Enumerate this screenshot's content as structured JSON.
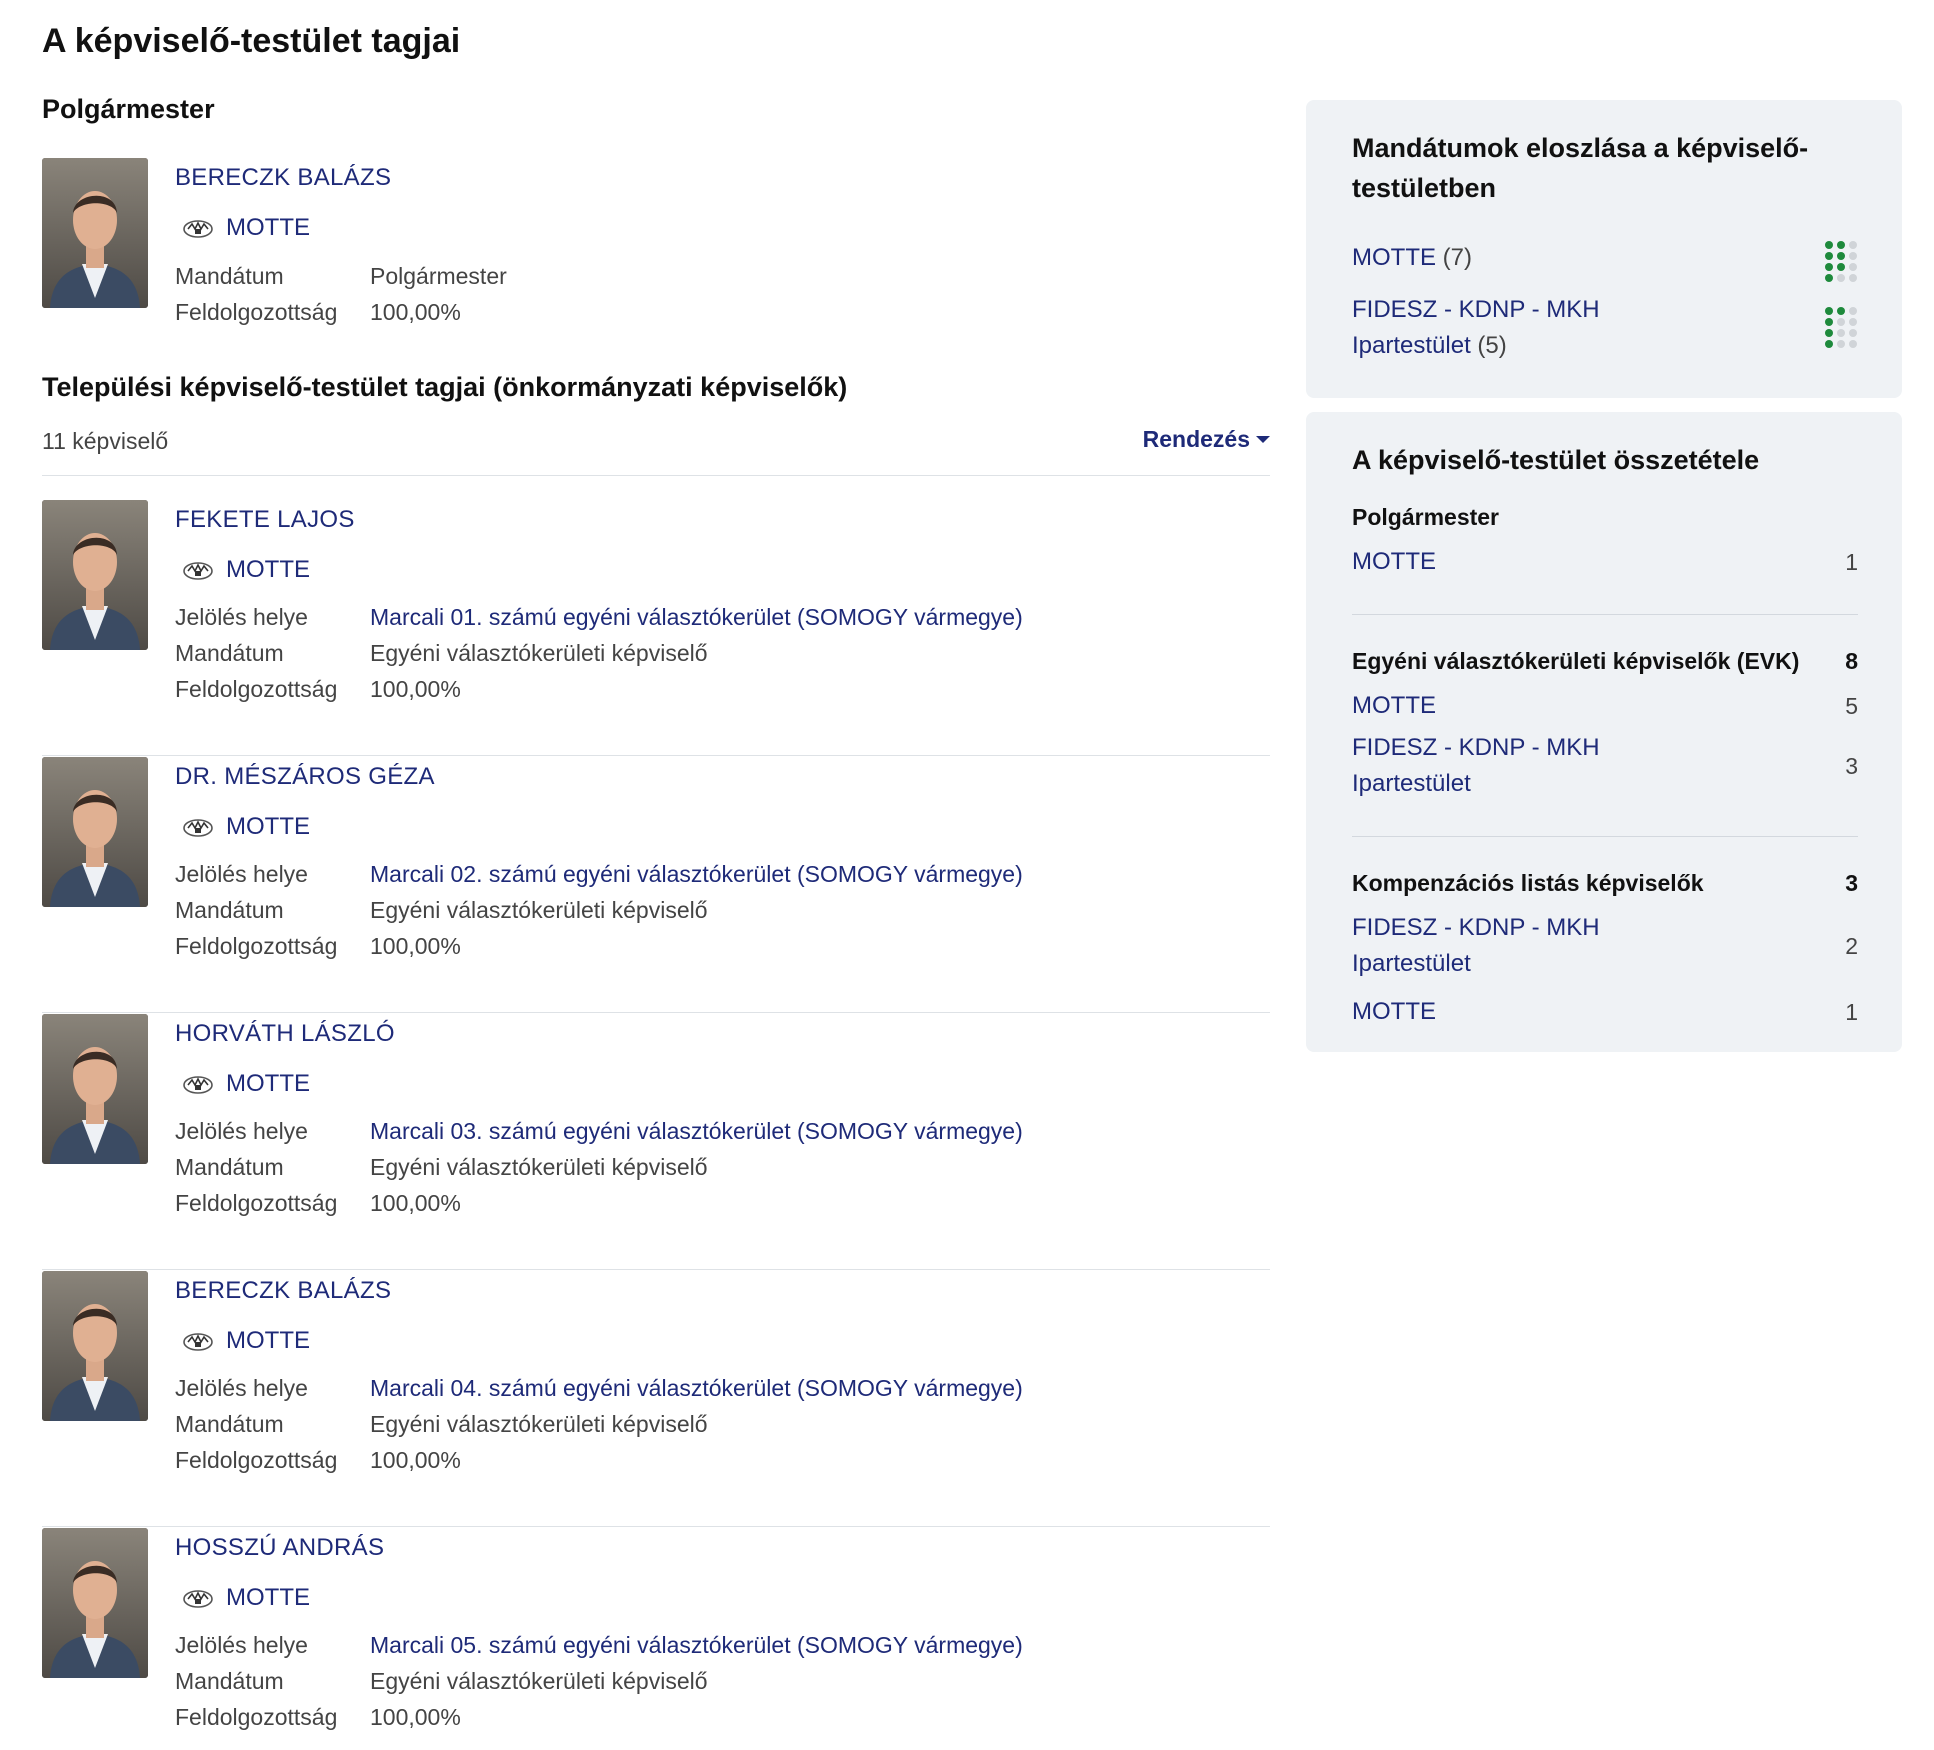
{
  "page_title": "A képviselő-testület tagjai",
  "mayor_section": {
    "title": "Polgármester",
    "person": {
      "name": "BERECZK BALÁZS",
      "party": "MOTTE",
      "fields": [
        {
          "label": "Mandátum",
          "value": "Polgármester"
        },
        {
          "label": "Feldolgozottság",
          "value": "100,00%"
        }
      ]
    }
  },
  "members_section": {
    "title": "Települési képviselő-testület tagjai (önkormányzati képviselők)",
    "count_text": "11 képviselő",
    "sort_label": "Rendezés",
    "members": [
      {
        "name": "FEKETE LAJOS",
        "party": "MOTTE",
        "jeloles_label": "Jelölés helye",
        "jeloles": "Marcali 01. számú egyéni választókerület (SOMOGY vármegye)",
        "mandatum_label": "Mandátum",
        "mandatum": "Egyéni választókerületi képviselő",
        "feldolg_label": "Feldolgozottság",
        "feldolg": "100,00%"
      },
      {
        "name": "DR. MÉSZÁROS GÉZA",
        "party": "MOTTE",
        "jeloles_label": "Jelölés helye",
        "jeloles": "Marcali 02. számú egyéni választókerület (SOMOGY vármegye)",
        "mandatum_label": "Mandátum",
        "mandatum": "Egyéni választókerületi képviselő",
        "feldolg_label": "Feldolgozottság",
        "feldolg": "100,00%"
      },
      {
        "name": "HORVÁTH LÁSZLÓ",
        "party": "MOTTE",
        "jeloles_label": "Jelölés helye",
        "jeloles": "Marcali 03. számú egyéni választókerület (SOMOGY vármegye)",
        "mandatum_label": "Mandátum",
        "mandatum": "Egyéni választókerületi képviselő",
        "feldolg_label": "Feldolgozottság",
        "feldolg": "100,00%"
      },
      {
        "name": "BERECZK BALÁZS",
        "party": "MOTTE",
        "jeloles_label": "Jelölés helye",
        "jeloles": "Marcali 04. számú egyéni választókerület (SOMOGY vármegye)",
        "mandatum_label": "Mandátum",
        "mandatum": "Egyéni választókerületi képviselő",
        "feldolg_label": "Feldolgozottság",
        "feldolg": "100,00%"
      },
      {
        "name": "HOSSZÚ ANDRÁS",
        "party": "MOTTE",
        "jeloles_label": "Jelölés helye",
        "jeloles": "Marcali 05. számú egyéni választókerület (SOMOGY vármegye)",
        "mandatum_label": "Mandátum",
        "mandatum": "Egyéni választókerületi képviselő",
        "feldolg_label": "Feldolgozottság",
        "feldolg": "100,00%"
      }
    ]
  },
  "distribution": {
    "title": "Mandátumok eloszlása a képviselő-testületben",
    "parties": [
      {
        "name": "MOTTE",
        "count": "(7)",
        "seats": 7,
        "total": 12,
        "color": "#1e8a3c"
      },
      {
        "name": "FIDESZ - KDNP - MKH Ipartestület",
        "count": "(5)",
        "seats": 5,
        "total": 12,
        "color": "#1e8a3c"
      }
    ]
  },
  "composition": {
    "title": "A képviselő-testület összetétele",
    "groups": [
      {
        "title": "Polgármester",
        "total": "",
        "rows": [
          {
            "name": "MOTTE",
            "count": "1"
          }
        ]
      },
      {
        "title": "Egyéni választókerületi képviselők (EVK)",
        "total": "8",
        "rows": [
          {
            "name": "MOTTE",
            "count": "5"
          },
          {
            "name": "FIDESZ - KDNP - MKH Ipartestület",
            "count": "3"
          }
        ]
      },
      {
        "title": "Kompenzációs listás képviselők",
        "total": "3",
        "rows": [
          {
            "name": "FIDESZ - KDNP - MKH Ipartestület",
            "count": "2"
          },
          {
            "name": "MOTTE",
            "count": "1"
          }
        ]
      }
    ]
  },
  "colors": {
    "link": "#1e2a78",
    "card_bg": "#eff2f5",
    "seat_filled": "#1e8a3c",
    "seat_empty": "#d0d4d8"
  }
}
